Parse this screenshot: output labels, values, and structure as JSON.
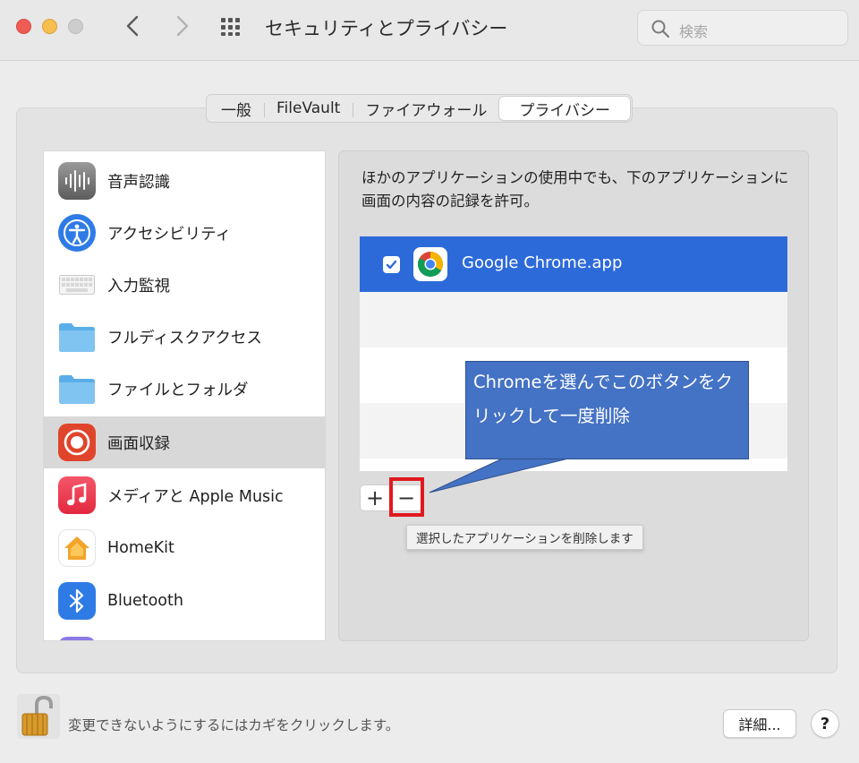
{
  "window": {
    "title": "セキュリティとプライバシー",
    "search_placeholder": "検索"
  },
  "tabs": [
    {
      "label": "一般",
      "active": false
    },
    {
      "label": "FileVault",
      "active": false
    },
    {
      "label": "ファイアウォール",
      "active": false
    },
    {
      "label": "プライバシー",
      "active": true
    }
  ],
  "sidebar": {
    "items": [
      {
        "label": "音声認識",
        "icon": "waveform-icon"
      },
      {
        "label": "アクセシビリティ",
        "icon": "accessibility-icon"
      },
      {
        "label": "入力監視",
        "icon": "keyboard-icon"
      },
      {
        "label": "フルディスクアクセス",
        "icon": "folder-icon"
      },
      {
        "label": "ファイルとフォルダ",
        "icon": "folder-icon"
      },
      {
        "label": "画面収録",
        "icon": "screen-record-icon",
        "selected": true
      },
      {
        "label": "メディアと Apple Music",
        "icon": "music-icon"
      },
      {
        "label": "HomeKit",
        "icon": "home-icon"
      },
      {
        "label": "Bluetooth",
        "icon": "bluetooth-icon"
      }
    ]
  },
  "main": {
    "description": "ほかのアプリケーションの使用中でも、下のアプリケーションに画面の内容の記録を許可。",
    "apps": [
      {
        "name": "Google Chrome.app",
        "checked": true,
        "selected": true
      }
    ],
    "add_label": "+",
    "remove_label": "−",
    "tooltip": "選択したアプリケーションを削除します",
    "callout": "Chromeを選んでこのボタンをクリックして一度削除"
  },
  "footer": {
    "lock_text": "変更できないようにするにはカギをクリックします。",
    "details_label": "詳細...",
    "help_label": "?"
  },
  "colors": {
    "selection_blue": "#2d6ad9",
    "callout_blue": "#4472c4",
    "highlight_red": "#e0191f"
  }
}
